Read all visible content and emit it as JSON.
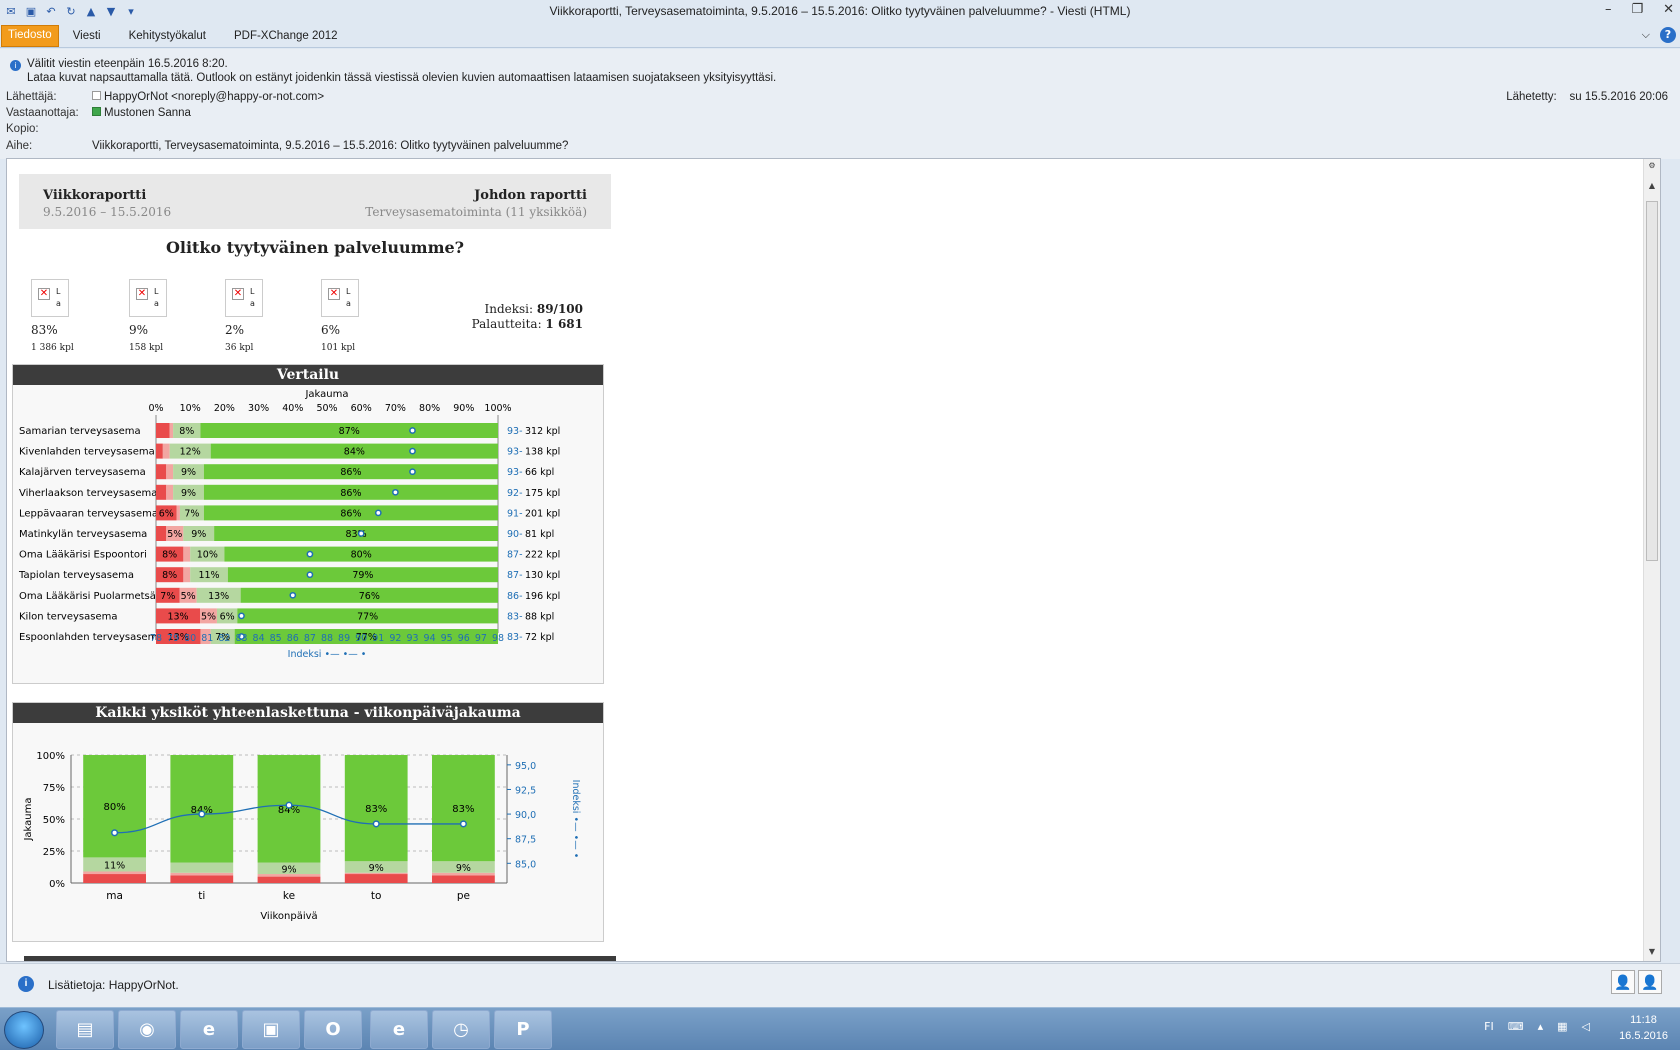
{
  "window": {
    "title": "Viikkoraportti, Terveysasematoiminta, 9.5.2016 – 15.5.2016: Olitko tyytyväinen palveluumme?  -  Viesti (HTML)"
  },
  "ribbon": {
    "tabs": [
      "Tiedosto",
      "Viesti",
      "Kehitystyökalut",
      "PDF-XChange 2012"
    ]
  },
  "message": {
    "info1": "Välitit viestin eteenpäin 16.5.2016 8:20.",
    "info2": "Lataa kuvat napsauttamalla tätä. Outlook on estänyt joidenkin tässä viestissä olevien kuvien automaattisen lataamisen suojatakseen yksityisyyttäsi.",
    "from_label": "Lähettäjä:",
    "from_value": "HappyOrNot <noreply@happy-or-not.com>",
    "to_label": "Vastaanottaja:",
    "to_value": "Mustonen Sanna",
    "cc_label": "Kopio:",
    "subject_label": "Aihe:",
    "subject_value": "Viikkoraportti, Terveysasematoiminta, 9.5.2016 – 15.5.2016: Olitko tyytyväinen palveluumme?",
    "sent_label": "Lähetetty:",
    "sent_value": "su 15.5.2016 20:06"
  },
  "report": {
    "left_title": "Viikkoraportti",
    "left_sub": "9.5.2016 – 15.5.2016",
    "right_title": "Johdon raportti",
    "right_sub": "Terveysasematoiminta (11 yksikköä)",
    "question": "Olitko tyytyväinen palveluumme?",
    "smileys": [
      {
        "pct": "83%",
        "count": "1 386 kpl"
      },
      {
        "pct": "9%",
        "count": "158 kpl"
      },
      {
        "pct": "2%",
        "count": "36 kpl"
      },
      {
        "pct": "6%",
        "count": "101 kpl"
      }
    ],
    "broken_img_text": [
      "L",
      "a"
    ],
    "index_label": "Indeksi: ",
    "index_value": "89/100",
    "feedback_label": "Palautteita: ",
    "feedback_value": "1 681",
    "section1_title": "Vertailu",
    "section2_title": "Kaikki yksiköt yhteenlaskettuna - viikonpäiväjakauma"
  },
  "chart_data": [
    {
      "type": "bar",
      "title": "Vertailu",
      "xlabel": "Jakauma",
      "x2label": "Indeksi •— •— •",
      "stacked": true,
      "orientation": "horizontal",
      "x_ticks": [
        "0%",
        "10%",
        "20%",
        "30%",
        "40%",
        "50%",
        "60%",
        "70%",
        "80%",
        "90%",
        "100%"
      ],
      "index_ticks": [
        78,
        79,
        80,
        81,
        82,
        83,
        84,
        85,
        86,
        87,
        88,
        89,
        90,
        91,
        92,
        93,
        94,
        95,
        96,
        97,
        98
      ],
      "index_range": [
        78,
        98
      ],
      "rows": [
        {
          "name": "Samarian terveysasema",
          "red": 4,
          "pink": 1,
          "light": 8,
          "green": 87,
          "index": 93,
          "count": "312 kpl",
          "labels": [
            "",
            "",
            "8%",
            "87%"
          ]
        },
        {
          "name": "Kivenlahden terveysasema",
          "red": 2,
          "pink": 2,
          "light": 12,
          "green": 84,
          "index": 93,
          "count": "138 kpl",
          "labels": [
            "",
            "",
            "12%",
            "84%"
          ]
        },
        {
          "name": "Kalajärven terveysasema",
          "red": 3,
          "pink": 2,
          "light": 9,
          "green": 86,
          "index": 93,
          "count": "66 kpl",
          "labels": [
            "",
            "",
            "9%",
            "86%"
          ]
        },
        {
          "name": "Viherlaakson terveysasema",
          "red": 3,
          "pink": 2,
          "light": 9,
          "green": 86,
          "index": 92,
          "count": "175 kpl",
          "labels": [
            "",
            "",
            "9%",
            "86%"
          ]
        },
        {
          "name": "Leppävaaran terveysasema",
          "red": 6,
          "pink": 1,
          "light": 7,
          "green": 86,
          "index": 91,
          "count": "201 kpl",
          "labels": [
            "6%",
            "",
            "7%",
            "86%"
          ]
        },
        {
          "name": "Matinkylän terveysasema",
          "red": 3,
          "pink": 5,
          "light": 9,
          "green": 83,
          "index": 90,
          "count": "81 kpl",
          "labels": [
            "",
            "5%",
            "9%",
            "83%"
          ]
        },
        {
          "name": "Oma Lääkärisi Espoontori",
          "red": 8,
          "pink": 2,
          "light": 10,
          "green": 80,
          "index": 87,
          "count": "222 kpl",
          "labels": [
            "8%",
            "",
            "10%",
            "80%"
          ]
        },
        {
          "name": "Tapiolan terveysasema",
          "red": 8,
          "pink": 2,
          "light": 11,
          "green": 79,
          "index": 87,
          "count": "130 kpl",
          "labels": [
            "8%",
            "",
            "11%",
            "79%"
          ]
        },
        {
          "name": "Oma Lääkärisi Puolarmetsä",
          "red": 7,
          "pink": 5,
          "light": 13,
          "green": 76,
          "index": 86,
          "count": "196 kpl",
          "labels": [
            "7%",
            "5%",
            "13%",
            "76%"
          ]
        },
        {
          "name": "Kilon terveysasema",
          "red": 13,
          "pink": 5,
          "light": 6,
          "green": 77,
          "index": 83,
          "count": "88 kpl",
          "labels": [
            "13%",
            "5%",
            "6%",
            "77%"
          ]
        },
        {
          "name": "Espoonlahden terveysasema",
          "red": 13,
          "pink": 3,
          "light": 7,
          "green": 77,
          "index": 83,
          "count": "72 kpl",
          "labels": [
            "13%",
            "",
            "7%",
            "77%"
          ]
        }
      ]
    },
    {
      "type": "bar",
      "title": "Kaikki yksiköt yhteenlaskettuna - viikonpäiväjakauma",
      "xlabel": "Viikonpäivä",
      "ylabel": "Jakauma",
      "y2label": "Indeksi •— •— •",
      "stacked": true,
      "categories": [
        "ma",
        "ti",
        "ke",
        "to",
        "pe"
      ],
      "y_ticks": [
        "0%",
        "25%",
        "50%",
        "75%",
        "100%"
      ],
      "y2_ticks": [
        "85,0",
        "87,5",
        "90,0",
        "92,5",
        "95,0"
      ],
      "y2_range": [
        83,
        96
      ],
      "red": [
        7,
        6,
        5,
        7,
        6
      ],
      "pink": [
        2,
        2,
        2,
        1,
        2
      ],
      "light": [
        11,
        8,
        9,
        9,
        9
      ],
      "green": [
        80,
        84,
        84,
        83,
        83
      ],
      "labels_green": [
        "80%",
        "84%",
        "84%",
        "83%",
        "83%"
      ],
      "labels_light": [
        "11%",
        "",
        "9%",
        "9%",
        "9%"
      ],
      "index": [
        88.1,
        90.0,
        90.9,
        89.0,
        89.0
      ]
    }
  ],
  "status": {
    "text": "Lisätietoja: HappyOrNot."
  },
  "taskbar": {
    "lang": "FI",
    "time": "11:18",
    "date": "16.5.2016"
  },
  "colors": {
    "red": "#e94b4b",
    "pink": "#f2a6a2",
    "light": "#b5d7a0",
    "green": "#6cc93a",
    "index": "#1f6fb5"
  }
}
